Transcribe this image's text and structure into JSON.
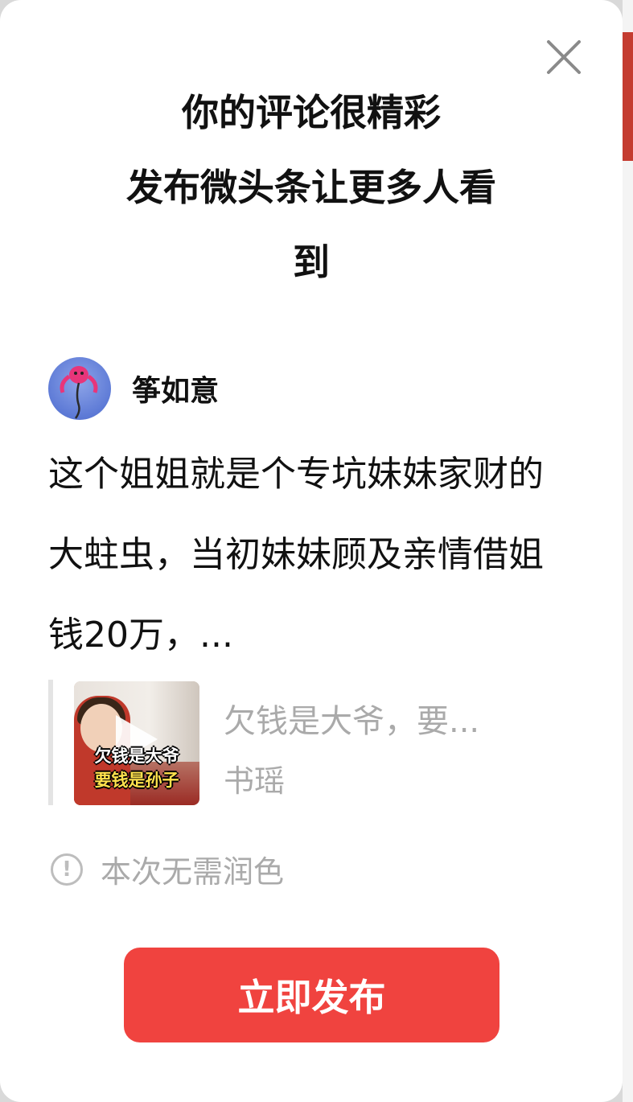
{
  "dialog": {
    "title_lines": [
      "你的评论很精彩",
      "发布微头条让更多人看",
      "到"
    ],
    "close_icon": "close-icon"
  },
  "author": {
    "name": "筝如意",
    "avatar_icon": "kite-avatar-icon"
  },
  "comment": {
    "text": "这个姐姐就是个专坑妹妹家财的大蛀虫，当初妹妹顾及亲情借姐钱20万，..."
  },
  "quoted_video": {
    "thumbnail_caption_line1": "欠钱是大爷",
    "thumbnail_caption_line2": "要钱是孙子",
    "title": "欠钱是大爷，要...",
    "source": "书瑶",
    "play_icon": "play-icon"
  },
  "notice": {
    "icon": "info-icon",
    "text": "本次无需润色"
  },
  "publish_button": {
    "label": "立即发布",
    "color": "#f0433f"
  },
  "colors": {
    "card_background": "#ffffff",
    "title_text": "#111111",
    "muted_text": "#aaaaaa"
  }
}
